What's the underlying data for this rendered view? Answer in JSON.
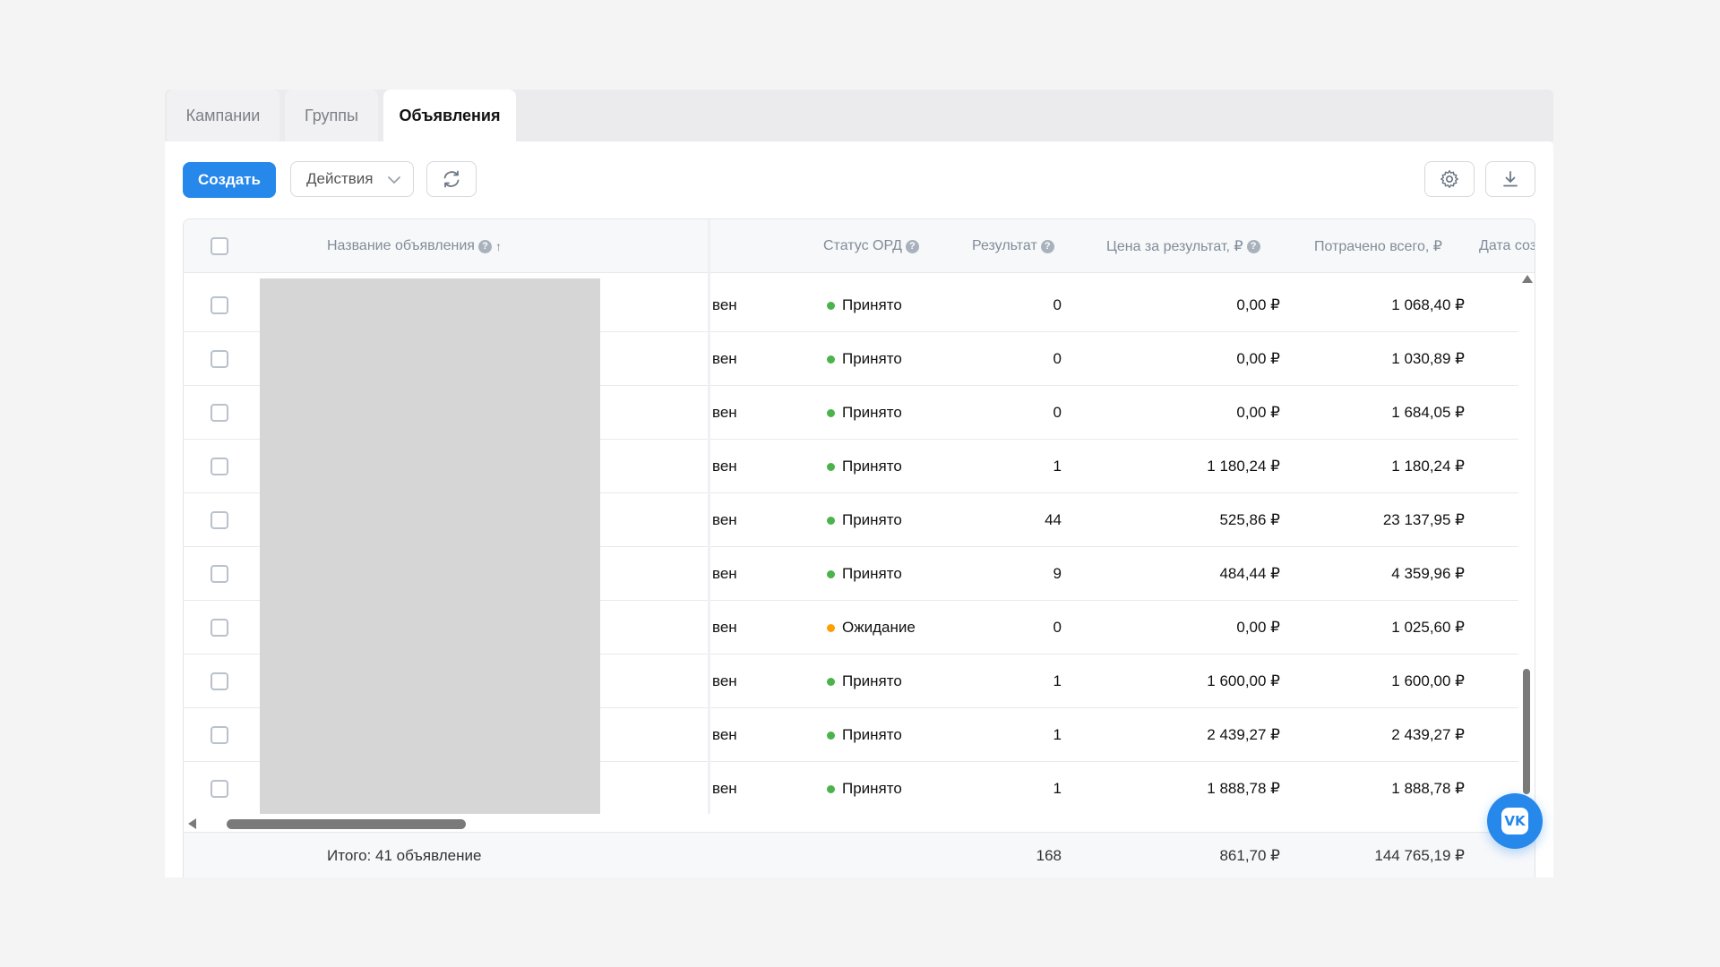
{
  "tabs": [
    {
      "label": "Кампании",
      "active": false
    },
    {
      "label": "Группы",
      "active": false
    },
    {
      "label": "Объявления",
      "active": true
    }
  ],
  "toolbar": {
    "create_label": "Создать",
    "actions_label": "Действия",
    "refresh_icon": "refresh-icon",
    "settings_icon": "gear-icon",
    "download_icon": "download-icon"
  },
  "columns": {
    "name": "Название объявления",
    "ord_status": "Статус ОРД",
    "result": "Результат",
    "cost_per_result": "Цена за результат, ₽",
    "spent_total": "Потрачено всего, ₽",
    "created": "Дата соз"
  },
  "rows": [
    {
      "truncated": "вен",
      "status": "Принято",
      "status_color": "#4bb34b",
      "result": "0",
      "cost": "0,00 ₽",
      "spent": "1 068,40 ₽"
    },
    {
      "truncated": "вен",
      "status": "Принято",
      "status_color": "#4bb34b",
      "result": "0",
      "cost": "0,00 ₽",
      "spent": "1 030,89 ₽"
    },
    {
      "truncated": "вен",
      "status": "Принято",
      "status_color": "#4bb34b",
      "result": "0",
      "cost": "0,00 ₽",
      "spent": "1 684,05 ₽"
    },
    {
      "truncated": "вен",
      "status": "Принято",
      "status_color": "#4bb34b",
      "result": "1",
      "cost": "1 180,24 ₽",
      "spent": "1 180,24 ₽"
    },
    {
      "truncated": "вен",
      "status": "Принято",
      "status_color": "#4bb34b",
      "result": "44",
      "cost": "525,86 ₽",
      "spent": "23 137,95 ₽"
    },
    {
      "truncated": "вен",
      "status": "Принято",
      "status_color": "#4bb34b",
      "result": "9",
      "cost": "484,44 ₽",
      "spent": "4 359,96 ₽"
    },
    {
      "truncated": "вен",
      "status": "Ожидание",
      "status_color": "#ffa000",
      "result": "0",
      "cost": "0,00 ₽",
      "spent": "1 025,60 ₽"
    },
    {
      "truncated": "вен",
      "status": "Принято",
      "status_color": "#4bb34b",
      "result": "1",
      "cost": "1 600,00 ₽",
      "spent": "1 600,00 ₽"
    },
    {
      "truncated": "вен",
      "status": "Принято",
      "status_color": "#4bb34b",
      "result": "1",
      "cost": "2 439,27 ₽",
      "spent": "2 439,27 ₽"
    },
    {
      "truncated": "вен",
      "status": "Принято",
      "status_color": "#4bb34b",
      "result": "1",
      "cost": "1 888,78 ₽",
      "spent": "1 888,78 ₽"
    }
  ],
  "footer": {
    "total_label": "Итого: 41 объявление",
    "result": "168",
    "cost": "861,70 ₽",
    "spent": "144 765,19 ₽"
  },
  "colors": {
    "accent": "#2688eb",
    "status_accepted": "#4bb34b",
    "status_pending": "#ffa000"
  },
  "fab": {
    "icon": "vk-logo-icon",
    "text": "VK"
  }
}
